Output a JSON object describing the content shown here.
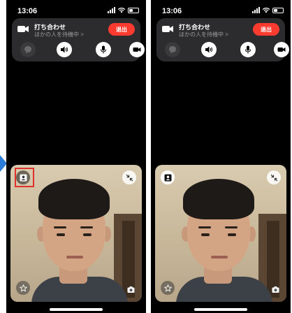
{
  "screens": [
    {
      "status": {
        "time": "13:06"
      },
      "call": {
        "title": "打ち合わせ",
        "subtitle": "ほかの人を待機中 >",
        "leave_label": "退出"
      },
      "controls": [
        "message-icon",
        "speaker-icon",
        "microphone-icon",
        "camera-icon"
      ],
      "self_view_button_highlighted": true
    },
    {
      "status": {
        "time": "13:06"
      },
      "call": {
        "title": "打ち合わせ",
        "subtitle": "ほかの人を待機中 >",
        "leave_label": "退出"
      },
      "controls": [
        "message-icon",
        "speaker-icon",
        "microphone-icon",
        "camera-icon"
      ],
      "self_view_button_highlighted": false
    }
  ],
  "colors": {
    "leave": "#ff3b30",
    "highlight": "#e0322c",
    "card": "#2c2c2e",
    "arrow": "#2b7bd9"
  }
}
